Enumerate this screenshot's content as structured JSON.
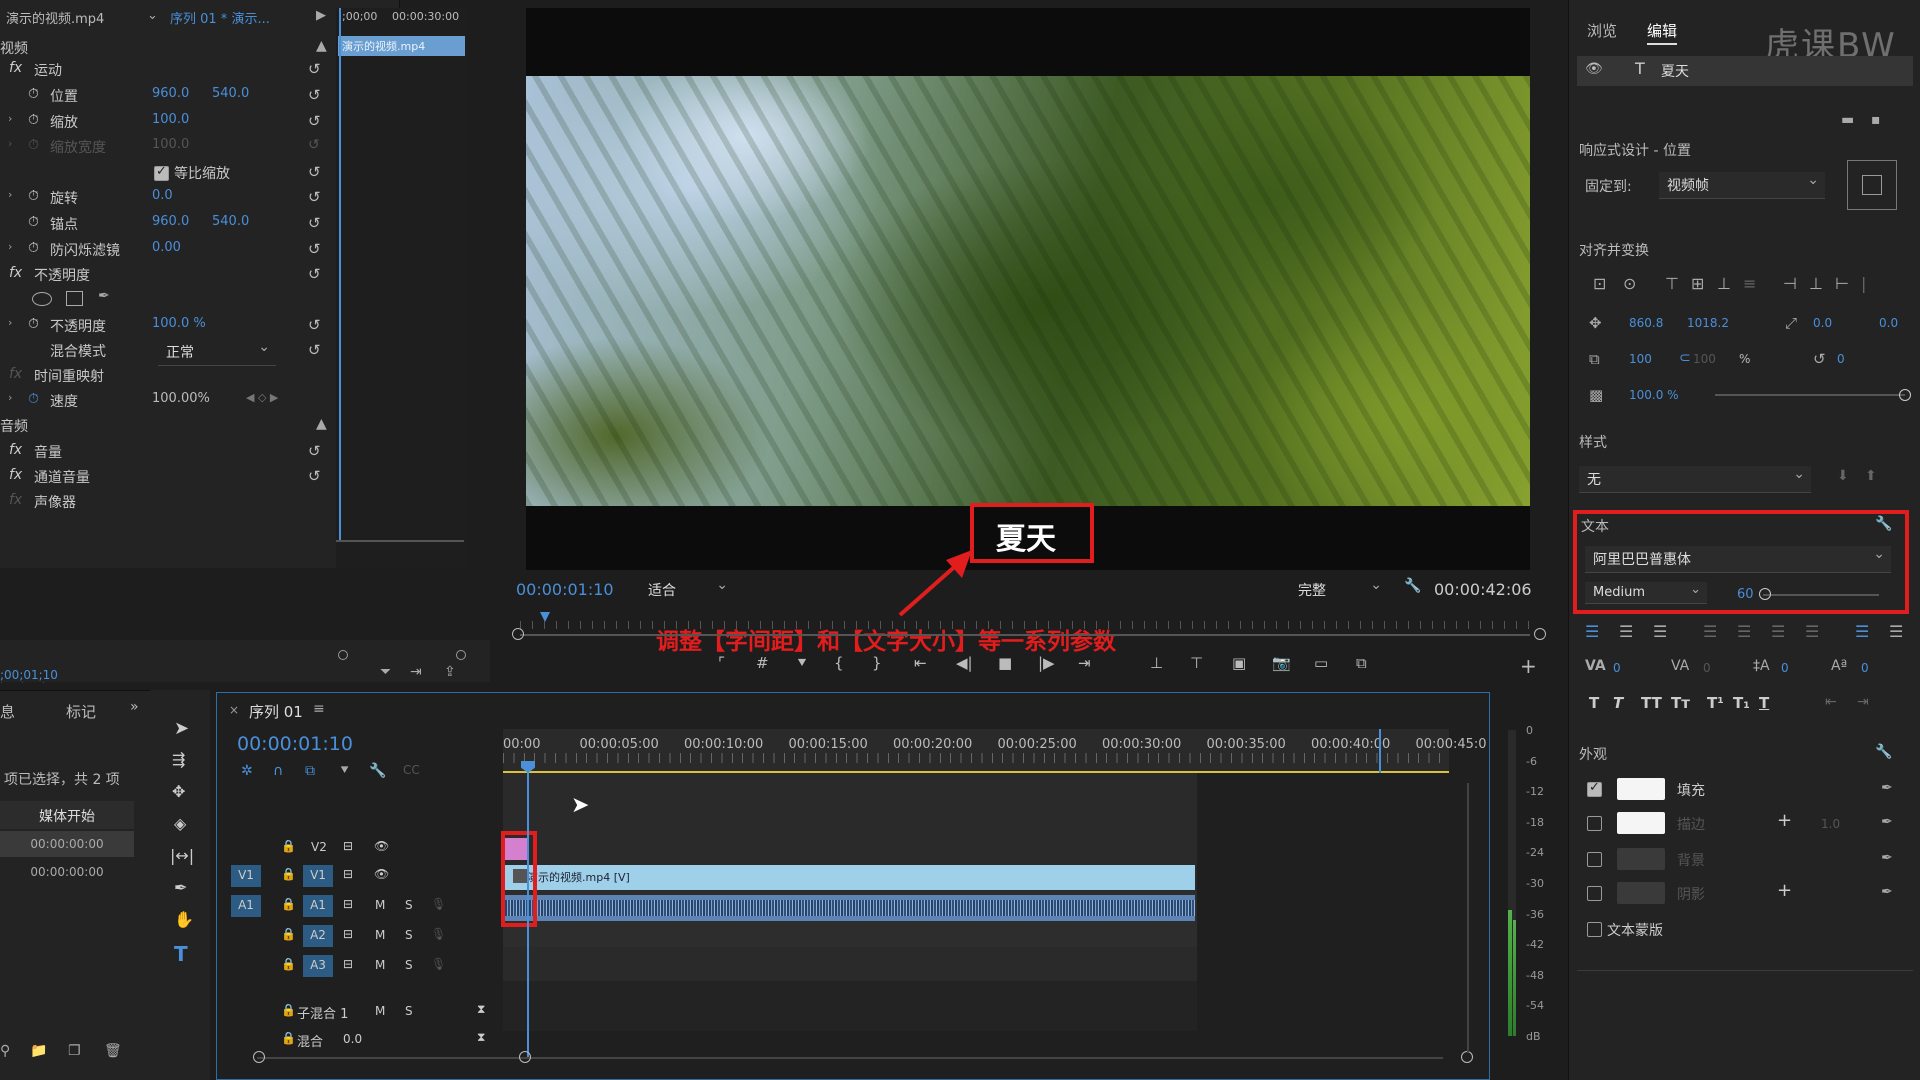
{
  "effect_controls": {
    "source_clip": "演示的视频.mp4",
    "sequence_clip": "序列 01 * 演示...",
    "mini_ruler_start": ";00;00",
    "mini_ruler_end": "00:00:30:00",
    "mini_clip": "演示的视频.mp4",
    "video_header": "视频",
    "motion": "运动",
    "position_label": "位置",
    "position_x": "960.0",
    "position_y": "540.0",
    "scale_label": "缩放",
    "scale_value": "100.0",
    "scale_width_label": "缩放宽度",
    "scale_width_value": "100.0",
    "uniform_scale": "等比缩放",
    "rotation_label": "旋转",
    "rotation_value": "0.0",
    "anchor_label": "锚点",
    "anchor_x": "960.0",
    "anchor_y": "540.0",
    "flicker_label": "防闪烁滤镜",
    "flicker_value": "0.00",
    "opacity_header": "不透明度",
    "opacity_label": "不透明度",
    "opacity_value": "100.0 %",
    "blend_label": "混合模式",
    "blend_value": "正常",
    "time_remap": "时间重映射",
    "speed_label": "速度",
    "speed_value": "100.00%",
    "audio_header": "音频",
    "volume": "音量",
    "channel_volume": "通道音量",
    "panner": "声像器",
    "timecode": ";00;01;10"
  },
  "monitor": {
    "caption": "夏天",
    "timecode": "00:00:01:10",
    "fit": "适合",
    "quality": "完整",
    "duration": "00:00:42:06",
    "annotation": "调整【字间距】和【文字大小】等一系列参数"
  },
  "project": {
    "tab_info": "息",
    "tab_markers": "标记",
    "selection_text": "项已选择，共 2 项",
    "column_media_start": "媒体开始",
    "row1": "00:00:00:00",
    "row2": "00:00:00:00"
  },
  "timeline": {
    "tab": "序列 01",
    "timecode": "00:00:01:10",
    "ruler": [
      "00:00",
      "00:00:05:00",
      "00:00:10:00",
      "00:00:15:00",
      "00:00:20:00",
      "00:00:25:00",
      "00:00:30:00",
      "00:00:35:00",
      "00:00:40:00",
      "00:00:45:0"
    ],
    "v2": "V2",
    "v1": "V1",
    "a1": "A1",
    "a2": "A2",
    "a3": "A3",
    "src_v1": "V1",
    "src_a1": "A1",
    "submix": "子混合 1",
    "mix": "混合",
    "mix_value": "0.0",
    "video_clip": "演示的视频.mp4 [V]",
    "m": "M",
    "s": "S"
  },
  "meter": {
    "labels": [
      "0",
      "-6",
      "-12",
      "-18",
      "-24",
      "-30",
      "-36",
      "-42",
      "-48",
      "-54",
      "dB"
    ]
  },
  "essential_graphics": {
    "tab_browse": "浏览",
    "tab_edit": "编辑",
    "layer_name": "夏天",
    "responsive_title": "响应式设计 - 位置",
    "pin_to_label": "固定到:",
    "pin_to_value": "视频帧",
    "align_title": "对齐并变换",
    "pos_x": "860.8",
    "pos_y": "1018.2",
    "anchor_x": "0.0",
    "anchor_y": "0.0",
    "scale": "100",
    "scale_h": "100",
    "pct": "%",
    "rotation": "0",
    "opacity": "100.0 %",
    "style_title": "样式",
    "style_value": "无",
    "text_title": "文本",
    "font": "阿里巴巴普惠体",
    "font_weight": "Medium",
    "font_size": "60",
    "tracking_val": "0",
    "kerning_val": "0",
    "leading_val": "0",
    "baseline_val": "0",
    "appearance_title": "外观",
    "fill": "填充",
    "stroke": "描边",
    "stroke_width": "1.0",
    "background": "背景",
    "shadow": "阴影",
    "text_mask": "文本蒙版",
    "type_buttons": [
      "T",
      "T",
      "TT",
      "Tт",
      "T¹",
      "T₁",
      "T"
    ]
  },
  "watermark": "虎课BW",
  "colors": {
    "accent": "#4a8fd9",
    "highlight_red": "#e11d1d",
    "clip_video": "#9fd0ea",
    "clip_graphic": "#d57fcf",
    "playhead": "#4a8fd9"
  }
}
